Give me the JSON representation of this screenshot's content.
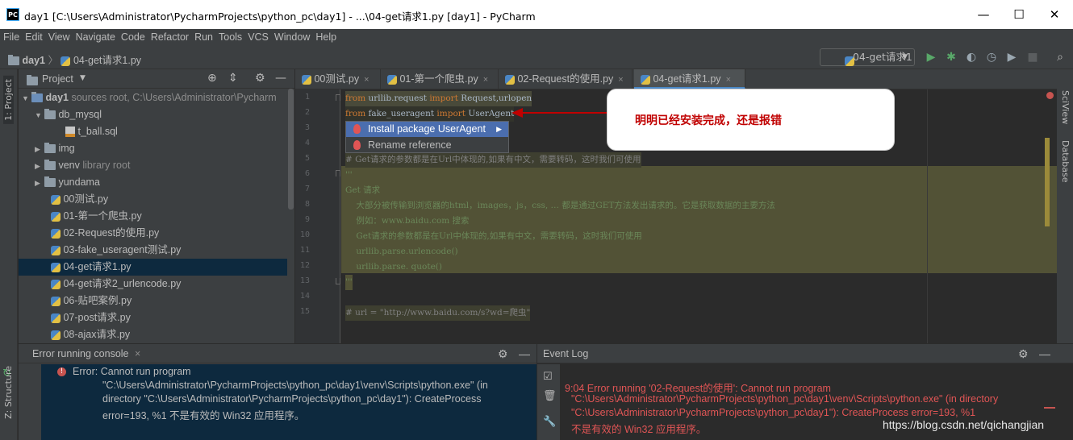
{
  "window": {
    "app_icon_text": "PC",
    "title": "day1 [C:\\Users\\Administrator\\PycharmProjects\\python_pc\\day1] - ...\\04-get请求1.py [day1] - PyCharm",
    "minimize": "—",
    "maximize": "☐",
    "close": "✕"
  },
  "menu": [
    "File",
    "Edit",
    "View",
    "Navigate",
    "Code",
    "Refactor",
    "Run",
    "Tools",
    "VCS",
    "Window",
    "Help"
  ],
  "breadcrumb": {
    "project": "day1",
    "file": "04-get请求1.py"
  },
  "run_config": "04-get请求1",
  "side_tabs": {
    "project": "1: Project",
    "structure": "Z: Structure",
    "sciview": "SciView",
    "database": "Database"
  },
  "project_panel": {
    "title": "Project",
    "root": {
      "name": "day1",
      "detail": "sources root,  C:\\Users\\Administrator\\Pycharm"
    },
    "items": [
      {
        "label": "db_mysql"
      },
      {
        "label": "t_ball.sql"
      },
      {
        "label": "img"
      },
      {
        "label": "venv",
        "detail": "library root"
      },
      {
        "label": "yundama"
      },
      {
        "label": "00测试.py"
      },
      {
        "label": "01-第一个爬虫.py"
      },
      {
        "label": "02-Request的使用.py"
      },
      {
        "label": "03-fake_useragent测试.py"
      },
      {
        "label": "04-get请求1.py"
      },
      {
        "label": "04-get请求2_urlencode.py"
      },
      {
        "label": "06-贴吧案例.py"
      },
      {
        "label": "07-post请求.py"
      },
      {
        "label": "08-ajax请求.py"
      }
    ]
  },
  "tabs": [
    {
      "label": "00测试.py"
    },
    {
      "label": "01-第一个爬虫.py"
    },
    {
      "label": "02-Request的使用.py"
    },
    {
      "label": "04-get请求1.py"
    }
  ],
  "tab_close": "×",
  "line_numbers": [
    "1",
    "2",
    "3",
    "4",
    "5",
    "6",
    "7",
    "8",
    "9",
    "10",
    "11",
    "12",
    "13",
    "14",
    "15"
  ],
  "code": {
    "l1_kw1": "from",
    "l1_mod": " urllib.request ",
    "l1_kw2": "import",
    "l1_rest": " Request,urlopen",
    "l2_kw1": "from",
    "l2_mod": " fake_useragent ",
    "l2_kw2": "import",
    "l2_rest": " UserAgent",
    "l5": "# Get请求的参数都是在Url中体现的,如果有中文，需要转码，这时我们可使用",
    "l6": "'''",
    "l7": "Get 请求",
    "l8": "    大部分被传输到浏览器的html，images，js，css, … 都是通过GET方法发出请求的。它是获取数据的主要方法",
    "l9": "    例如：www.baidu.com 搜索",
    "l10": "    Get请求的参数都是在Url中体现的,如果有中文，需要转码，这时我们可使用",
    "l11": "    urllib.parse.urlencode()",
    "l12": "    urllib.parse. quote()",
    "l13": "'''",
    "l15": "# url = \"http://www.baidu.com/s?wd=爬虫\""
  },
  "popup": {
    "install": "Install package UserAgent",
    "rename": "Rename reference"
  },
  "callout": "明明已经安装完成，还是报错",
  "console": {
    "title": "Error running console",
    "close": "×",
    "line1": "Error: Cannot run program",
    "line2": "\"C:\\Users\\Administrator\\PycharmProjects\\python_pc\\day1\\venv\\Scripts\\python.exe\" (in",
    "line3": "directory \"C:\\Users\\Administrator\\PycharmProjects\\python_pc\\day1\"): CreateProcess",
    "line4": "error=193, %1 不是有效的 Win32 应用程序。"
  },
  "event_log": {
    "title": "Event Log",
    "line1": "9:04  Error running '02-Request的使用': Cannot run program",
    "line2": "\"C:\\Users\\Administrator\\PycharmProjects\\python_pc\\day1\\venv\\Scripts\\python.exe\" (in directory",
    "line3": "\"C:\\Users\\Administrator\\PycharmProjects\\python_pc\\day1\"): CreateProcess error=193, %1",
    "line4": "不是有效的 Win32 应用程序。"
  },
  "watermark": "https://blog.csdn.net/qichangjian",
  "colors": {
    "accent": "#4a88c7",
    "error": "#e05555",
    "callout_text": "#c00000"
  }
}
